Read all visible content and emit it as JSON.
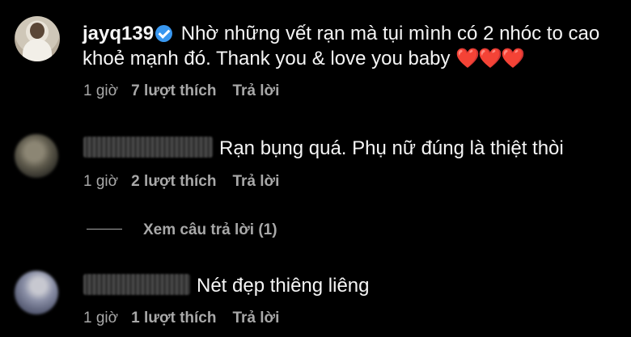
{
  "comments": [
    {
      "username": "jayq139",
      "verified": true,
      "text_line1": "Nhờ những vết rạn mà tụi mình có 2 nhóc to cao",
      "text_line2": "khoẻ mạnh đó. Thank you & love you baby",
      "hearts": "❤️❤️❤️",
      "time": "1 giờ",
      "likes": "7 lượt thích",
      "reply": "Trả lời"
    },
    {
      "text": "Rạn bụng quá. Phụ nữ đúng là thiệt thòi",
      "time": "1 giờ",
      "likes": "2 lượt thích",
      "reply": "Trả lời",
      "view_replies": "Xem câu trả lời (1)"
    },
    {
      "text": "Nét đẹp thiêng liêng",
      "time": "1 giờ",
      "likes": "1 lượt thích",
      "reply": "Trả lời"
    }
  ],
  "icons": {
    "verified": "verified-badge-icon"
  },
  "colors": {
    "background": "#000000",
    "text": "#f5f5f5",
    "meta": "#a8a8a8",
    "verified": "#3897f0",
    "heart": "#ed1c3e"
  }
}
